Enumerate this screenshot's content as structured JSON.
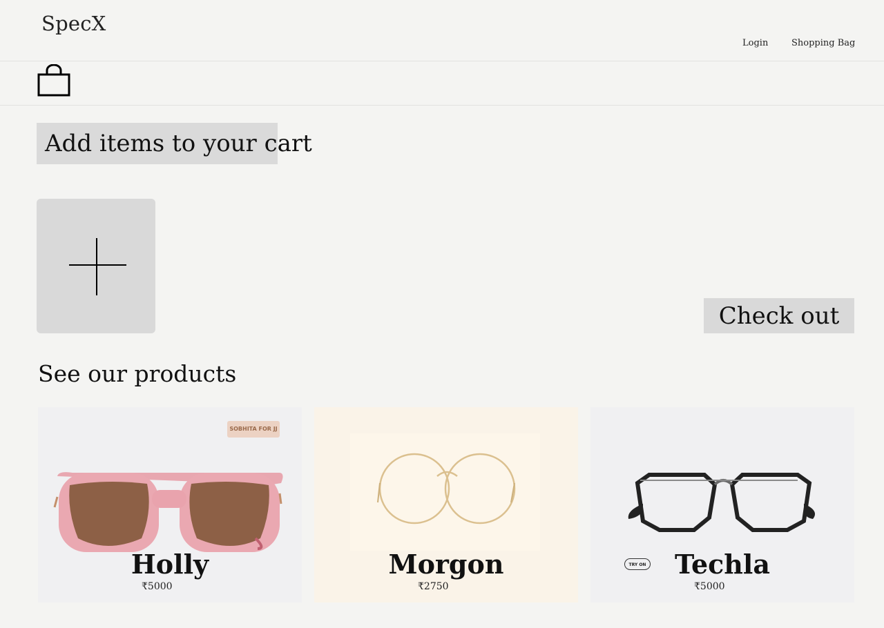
{
  "header": {
    "brand": "SpecX",
    "nav": {
      "login": "Login",
      "shopping_bag": "Shopping Bag"
    }
  },
  "cart": {
    "title": "Add items to your cart",
    "checkout_label": "Check out"
  },
  "products": {
    "heading": "See our products",
    "items": [
      {
        "name": "Holly",
        "price": "₹5000",
        "badge": "SOBHITA FOR JJ"
      },
      {
        "name": "Morgon",
        "price": "₹2750"
      },
      {
        "name": "Techla",
        "price": "₹5000",
        "tag": "TRY ON"
      }
    ]
  }
}
